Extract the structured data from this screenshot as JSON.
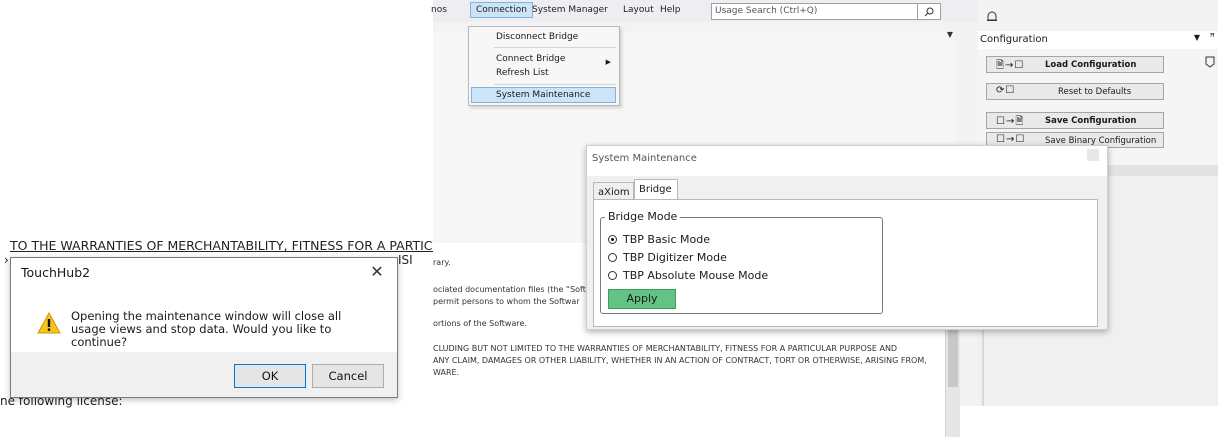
{
  "background_fragment": {
    "line1": "TO THE WARRANTIES OF MERCHANTABILITY, FITNESS FOR A PARTICULAR PUR",
    "line2": "›",
    "line2_right": "ISI",
    "line4": "ne following license:"
  },
  "dialog": {
    "title": "TouchHub2",
    "message": "Opening the maintenance window will close all usage views and stop data. Would you like to continue?",
    "ok_label": "OK",
    "cancel_label": "Cancel"
  },
  "menubar": {
    "items": [
      "nos",
      "Connection",
      "System Manager",
      "Layout",
      "Help"
    ],
    "search_placeholder": "Usage Search (Ctrl+Q)"
  },
  "connection_menu": {
    "items": [
      "Disconnect Bridge",
      "Connect Bridge",
      "Refresh List",
      "System Maintenance"
    ]
  },
  "document": {
    "lines": [
      "rary.",
      "ociated documentation files (the “Soft",
      " permit persons to whom the Softwar",
      "ortions of the Software.",
      "CLUDING BUT NOT LIMITED TO THE WARRANTIES OF MERCHANTABILITY, FITNESS FOR A PARTICULAR PURPOSE AND",
      "ANY CLAIM, DAMAGES OR OTHER LIABILITY, WHETHER IN AN ACTION OF CONTRACT, TORT OR OTHERWISE, ARISING FROM,",
      "WARE."
    ]
  },
  "config_panel": {
    "header": "Configuration",
    "buttons": [
      {
        "icon": "🗎→☐",
        "label": "Load Configuration"
      },
      {
        "icon": "⟳☐",
        "label": "Reset to Defaults"
      },
      {
        "icon": "☐→🗎",
        "label": "Save Configuration"
      },
      {
        "icon": "☐→☐",
        "label": "Save Binary Configuration"
      }
    ]
  },
  "system_maintenance": {
    "title": "System Maintenance",
    "tabs": [
      "aXiom",
      "Bridge"
    ],
    "active_tab": "Bridge",
    "group_title": "Bridge Mode",
    "options": [
      "TBP Basic Mode",
      "TBP Digitizer Mode",
      "TBP Absolute Mouse Mode"
    ],
    "selected_option": "TBP Basic Mode",
    "apply_label": "Apply"
  },
  "colors": {
    "accent": "#0078d7",
    "menu_highlight": "#cde4f7",
    "apply_green": "#63c384"
  }
}
